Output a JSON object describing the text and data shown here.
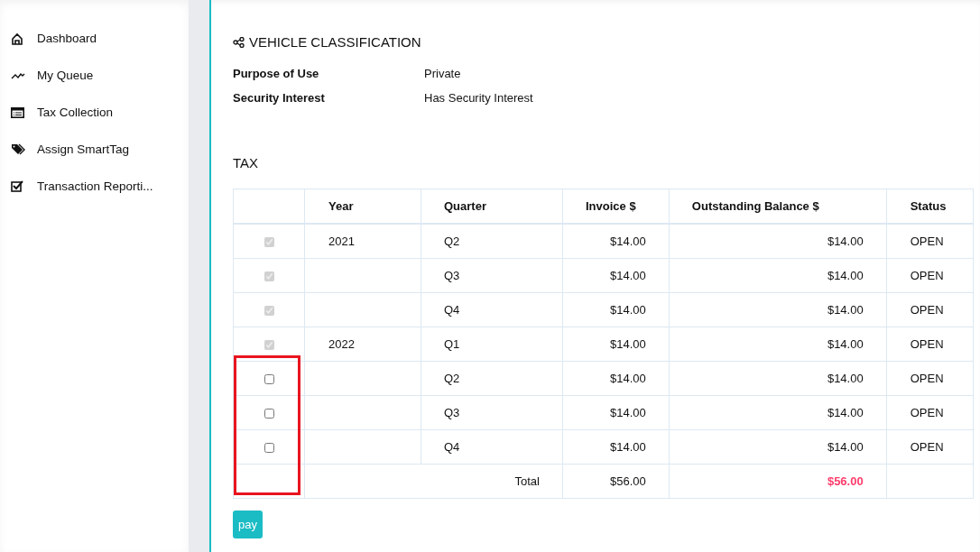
{
  "sidebar": {
    "items": [
      {
        "label": "Dashboard"
      },
      {
        "label": "My Queue"
      },
      {
        "label": "Tax Collection"
      },
      {
        "label": "Assign SmartTag"
      },
      {
        "label": "Transaction Reporti..."
      }
    ]
  },
  "vehicle_classification": {
    "title": "VEHICLE CLASSIFICATION",
    "fields": [
      {
        "label": "Purpose of Use",
        "value": "Private"
      },
      {
        "label": "Security Interest",
        "value": "Has Security Interest"
      }
    ]
  },
  "tax": {
    "title": "TAX",
    "columns": [
      "Year",
      "Quarter",
      "Invoice $",
      "Outstanding Balance $",
      "Status"
    ],
    "rows": [
      {
        "checked": true,
        "disabled": true,
        "year": "2021",
        "quarter": "Q2",
        "invoice": "$14.00",
        "balance": "$14.00",
        "status": "OPEN"
      },
      {
        "checked": true,
        "disabled": true,
        "quarter": "Q3",
        "invoice": "$14.00",
        "balance": "$14.00",
        "status": "OPEN"
      },
      {
        "checked": true,
        "disabled": true,
        "quarter": "Q4",
        "invoice": "$14.00",
        "balance": "$14.00",
        "status": "OPEN"
      },
      {
        "checked": true,
        "disabled": true,
        "year": "2022",
        "quarter": "Q1",
        "invoice": "$14.00",
        "balance": "$14.00",
        "status": "OPEN"
      },
      {
        "checked": false,
        "disabled": false,
        "quarter": "Q2",
        "invoice": "$14.00",
        "balance": "$14.00",
        "status": "OPEN"
      },
      {
        "checked": false,
        "disabled": false,
        "quarter": "Q3",
        "invoice": "$14.00",
        "balance": "$14.00",
        "status": "OPEN"
      },
      {
        "checked": false,
        "disabled": false,
        "quarter": "Q4",
        "invoice": "$14.00",
        "balance": "$14.00",
        "status": "OPEN"
      }
    ],
    "total": {
      "label": "Total",
      "invoice": "$56.00",
      "balance": "$56.00"
    },
    "button": "pay"
  }
}
